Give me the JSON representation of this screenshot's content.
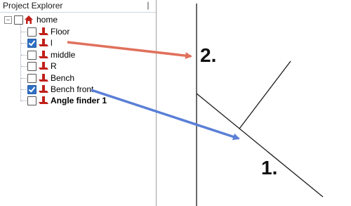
{
  "panel": {
    "title": "Project Explorer",
    "pin_glyph": "❘"
  },
  "tree": {
    "root": {
      "label": "home",
      "icon": "house-icon",
      "expander": "−"
    },
    "items": [
      {
        "label": "Floor",
        "checked": false,
        "icon": "plane-icon"
      },
      {
        "label": "l",
        "checked": true,
        "icon": "plane-icon"
      },
      {
        "label": "middle",
        "checked": false,
        "icon": "plane-icon"
      },
      {
        "label": "R",
        "checked": false,
        "icon": "plane-icon"
      },
      {
        "label": "Bench",
        "checked": false,
        "icon": "plane-icon"
      },
      {
        "label": "Bench front",
        "checked": true,
        "icon": "plane-icon"
      },
      {
        "label": "Angle finder 1",
        "checked": false,
        "icon": "plane-icon",
        "bold": true
      }
    ]
  },
  "annotations": {
    "label_2": "2.",
    "label_1": "1."
  },
  "colors": {
    "arrow_red": "#e0715c",
    "arrow_blue": "#5a7fd6",
    "icon_red": "#c0201a"
  }
}
